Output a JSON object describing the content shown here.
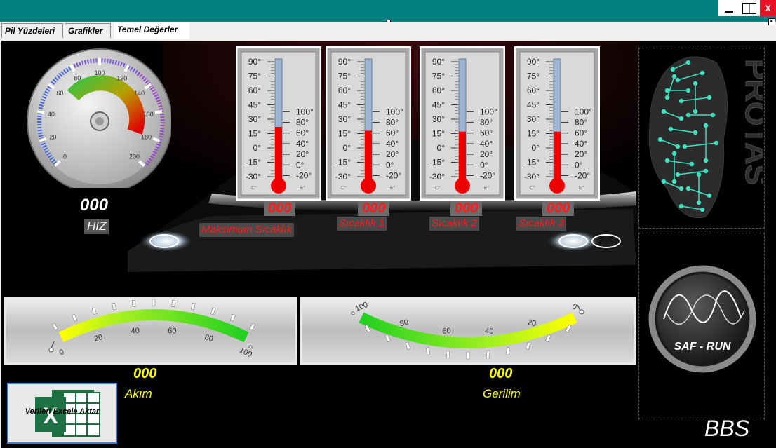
{
  "window": {
    "minimize_icon": "minimize-icon",
    "maximize_icon": "maximize-icon",
    "close_label": "X"
  },
  "tabs": [
    {
      "label": "Pil Yüzdeleri"
    },
    {
      "label": "Grafikler"
    },
    {
      "label": "Temel Değerler"
    }
  ],
  "speed": {
    "value": "000",
    "label": "HIZ",
    "ticks": [
      "0",
      "20",
      "40",
      "60",
      "80",
      "100",
      "120",
      "140",
      "160",
      "180",
      "200"
    ]
  },
  "thermometers": [
    {
      "value": "000",
      "label": "Maksimum Sıcaklık",
      "level_c": 22
    },
    {
      "value": "000",
      "label": "Sıcaklık 1",
      "level_c": 18
    },
    {
      "value": "000",
      "label": "Sıcaklık 2",
      "level_c": 17
    },
    {
      "value": "000",
      "label": "Sıcaklık 3",
      "level_c": 17
    }
  ],
  "thermo_scale": {
    "celsius": [
      "90°",
      "75°",
      "60°",
      "45°",
      "30°",
      "15°",
      "0°",
      "-15°",
      "-30°"
    ],
    "fahrenheit": [
      "100°",
      "80°",
      "60°",
      "40°",
      "20°",
      "0°",
      "-20°"
    ],
    "c_unit": "C°",
    "f_unit": "F°"
  },
  "current": {
    "value": "000",
    "label": "Akım",
    "ticks": [
      "0",
      "20",
      "40",
      "60",
      "80",
      "100"
    ]
  },
  "voltage": {
    "value": "000",
    "label": "Gerilim",
    "ticks": [
      "100",
      "80",
      "60",
      "40",
      "20",
      "0"
    ]
  },
  "logos": {
    "protas": "PROTAS",
    "safrun": "SAF - RUN",
    "bbs": "BBS"
  },
  "excel_button": {
    "label": "Verileri Excele Aktar",
    "icon": "excel-icon"
  },
  "colors": {
    "titlebar": "#008080",
    "readout_red": "#ff1a1a",
    "readout_yellow": "#ffff00",
    "circuit": "#3de0c0"
  }
}
